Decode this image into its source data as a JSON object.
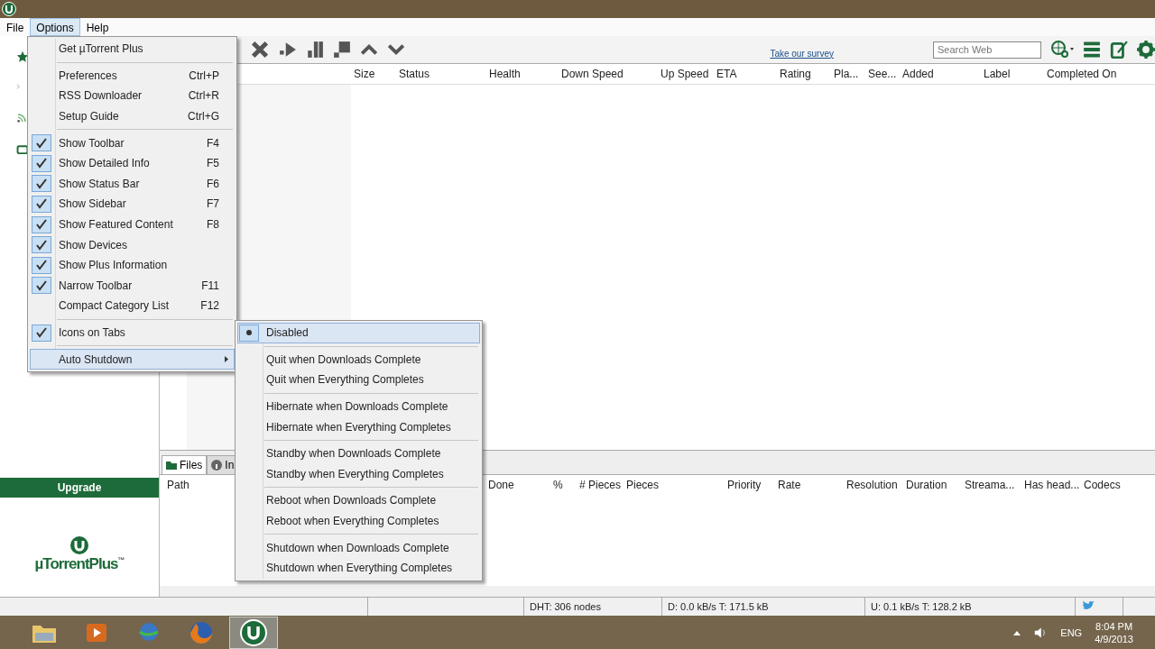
{
  "menu_bar": [
    {
      "label": "File",
      "selected": false
    },
    {
      "label": "Options",
      "selected": true
    },
    {
      "label": "Help",
      "selected": false
    }
  ],
  "options_menu": {
    "groups": [
      {
        "items": [
          {
            "label": "Get µTorrent Plus"
          }
        ]
      },
      {
        "items": [
          {
            "label": "Preferences",
            "shortcut": "Ctrl+P"
          },
          {
            "label": "RSS Downloader",
            "shortcut": "Ctrl+R"
          },
          {
            "label": "Setup Guide",
            "shortcut": "Ctrl+G"
          }
        ]
      },
      {
        "items": [
          {
            "label": "Show Toolbar",
            "shortcut": "F4",
            "checked": true
          },
          {
            "label": "Show Detailed Info",
            "shortcut": "F5",
            "checked": true
          },
          {
            "label": "Show Status Bar",
            "shortcut": "F6",
            "checked": true
          },
          {
            "label": "Show Sidebar",
            "shortcut": "F7",
            "checked": true
          },
          {
            "label": "Show Featured Content",
            "shortcut": "F8",
            "checked": true
          },
          {
            "label": "Show Devices",
            "checked": true
          },
          {
            "label": "Show Plus Information",
            "checked": true
          },
          {
            "label": "Narrow Toolbar",
            "shortcut": "F11",
            "checked": true
          },
          {
            "label": "Compact Category List",
            "shortcut": "F12",
            "checked": false
          }
        ]
      },
      {
        "items": [
          {
            "label": "Icons on Tabs",
            "checked": true
          }
        ]
      },
      {
        "items": [
          {
            "label": "Auto Shutdown",
            "submenu": true,
            "selected": true
          }
        ]
      }
    ]
  },
  "auto_shutdown_menu": {
    "groups": [
      {
        "items": [
          {
            "label": "Disabled",
            "selected": true
          }
        ]
      },
      {
        "items": [
          {
            "label": "Quit when Downloads Complete",
            "selected": false
          },
          {
            "label": "Quit when Everything Completes",
            "selected": false
          }
        ]
      },
      {
        "items": [
          {
            "label": "Hibernate when Downloads Complete",
            "selected": false
          },
          {
            "label": "Hibernate when Everything Completes",
            "selected": false
          }
        ]
      },
      {
        "items": [
          {
            "label": "Standby when Downloads Complete",
            "selected": false
          },
          {
            "label": "Standby when Everything Completes",
            "selected": false
          }
        ]
      },
      {
        "items": [
          {
            "label": "Reboot when Downloads Complete",
            "selected": false
          },
          {
            "label": "Reboot when Everything Completes",
            "selected": false
          }
        ]
      },
      {
        "items": [
          {
            "label": "Shutdown when Downloads Complete",
            "selected": false
          },
          {
            "label": "Shutdown when Everything Completes",
            "selected": false
          }
        ]
      }
    ]
  },
  "toolbar": {
    "survey_link": "Take our survey",
    "search": {
      "placeholder": "Search Web"
    }
  },
  "torrent_table": {
    "columns": [
      "Size",
      "Status",
      "Health",
      "Down Speed",
      "Up Speed",
      "ETA",
      "Rating",
      "Pla...",
      "See...",
      "Added",
      "Label",
      "Completed On"
    ]
  },
  "sidebar": {
    "upgrade_button": "Upgrade",
    "logo": {
      "name": "µTorrentPlus",
      "mark": "™"
    }
  },
  "detail_tabs": [
    {
      "label": "Files",
      "selected": true
    },
    {
      "label": "In",
      "selected": false
    }
  ],
  "files_table": {
    "columns": [
      "Path",
      "Done",
      "%",
      "# Pieces",
      "Pieces",
      "Priority",
      "Rate",
      "Resolution",
      "Duration",
      "Streama...",
      "Has head...",
      "Codecs"
    ]
  },
  "status_bar": {
    "dht": "DHT: 306 nodes",
    "download": "D: 0.0 kB/s T: 171.5 kB",
    "upload": "U: 0.1 kB/s T: 128.2 kB"
  },
  "taskbar": {
    "apps": [
      {
        "kind": "folder",
        "selected": false
      },
      {
        "kind": "media",
        "selected": false
      },
      {
        "kind": "download",
        "selected": false
      },
      {
        "kind": "browser",
        "selected": false
      },
      {
        "kind": "torrent",
        "selected": true
      }
    ],
    "language": "ENG",
    "time": "8:04 PM",
    "date": "4/9/2013"
  }
}
